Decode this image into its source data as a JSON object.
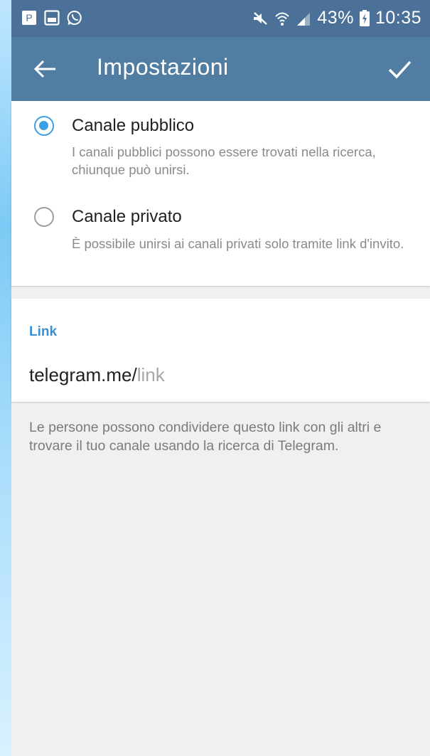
{
  "status_bar": {
    "battery": "43%",
    "time": "10:35",
    "icons": [
      "p-icon",
      "gallery-icon",
      "whatsapp-icon",
      "mute-icon",
      "wifi-icon",
      "signal-icon",
      "battery-icon"
    ]
  },
  "header": {
    "title": "Impostazioni",
    "back_icon": "back-arrow-icon",
    "done_icon": "check-icon"
  },
  "options": [
    {
      "label": "Canale pubblico",
      "description": "I canali pubblici possono essere trovati nella ricerca, chiunque può unirsi.",
      "checked": true
    },
    {
      "label": "Canale privato",
      "description": "È possibile unirsi ai canali privati solo tramite link d'invito.",
      "checked": false
    }
  ],
  "link": {
    "header": "Link",
    "prefix": "telegram.me/",
    "placeholder": "link"
  },
  "help_text": "Le persone possono condividere questo link con gli altri e trovare il tuo canale usando la ricerca di Telegram.",
  "colors": {
    "status_bar": "#4c7198",
    "action_bar": "#517da2",
    "accent": "#3ba0e6",
    "link_header": "#3a8fd0"
  }
}
